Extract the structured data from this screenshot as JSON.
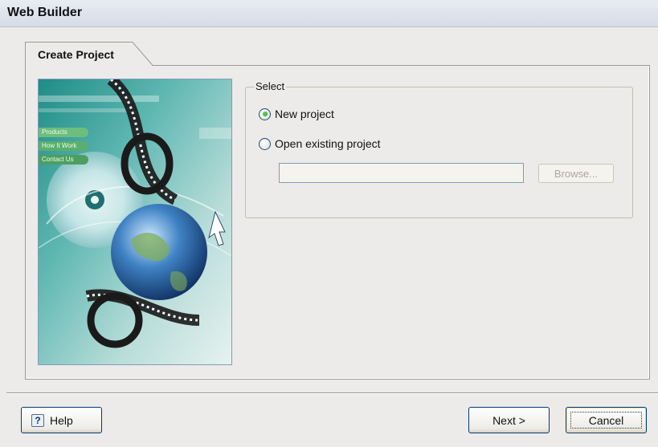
{
  "window": {
    "title": "Web Builder"
  },
  "tabs": [
    {
      "label": "Create Project"
    }
  ],
  "select_group": {
    "legend": "Select",
    "options": [
      {
        "label": "New project",
        "checked": true
      },
      {
        "label": "Open existing project",
        "checked": false
      }
    ],
    "path_input": {
      "value": "",
      "placeholder": ""
    },
    "browse_label": "Browse..."
  },
  "banner_menu": [
    "Products",
    "How It Work",
    "Contact Us"
  ],
  "buttons": {
    "help": "Help",
    "next": "Next >",
    "cancel": "Cancel"
  },
  "colors": {
    "title_bar": "#dfe3ec",
    "dialog_bg": "#ecebe9",
    "button_border": "#003c74",
    "radio_checked": "#21a121"
  }
}
